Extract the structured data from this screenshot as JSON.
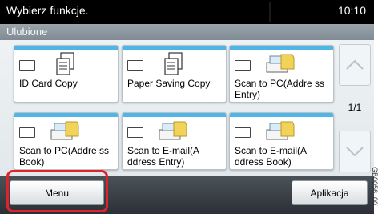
{
  "titlebar": {
    "title": "Wybierz funkcje.",
    "time": "10:10"
  },
  "subtitle": "Ulubione",
  "tiles": [
    {
      "label": "ID Card Copy",
      "icon": "copy-document-icon"
    },
    {
      "label": "Paper Saving Copy",
      "icon": "copy-document-icon"
    },
    {
      "label": "Scan to PC(Addre ss Entry)",
      "icon": "scan-to-folder-icon"
    },
    {
      "label": "Scan to PC(Addre ss Book)",
      "icon": "scan-to-folder-icon"
    },
    {
      "label": "Scan to E-mail(A ddress Entry)",
      "icon": "scan-to-folder-icon"
    },
    {
      "label": "Scan to E-mail(A ddress Book)",
      "icon": "scan-to-folder-icon"
    }
  ],
  "pager": "1/1",
  "buttons": {
    "menu": "Menu",
    "apps": "Aplikacja"
  },
  "side_code": "GB0056_00",
  "colors": {
    "highlight": "#e0232b",
    "tile_accent": "#4fb5e6"
  }
}
